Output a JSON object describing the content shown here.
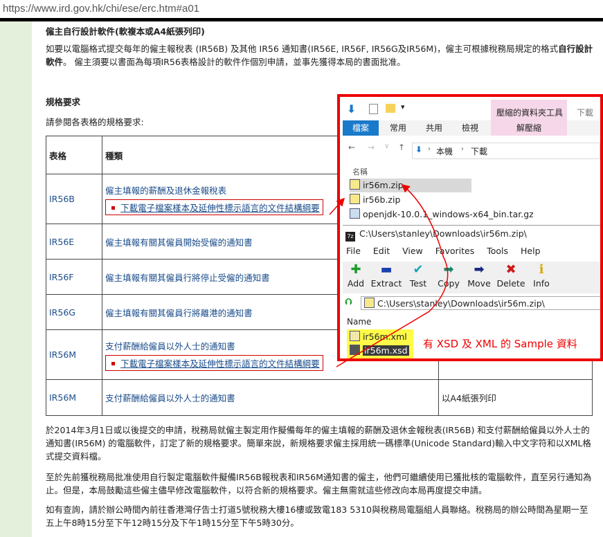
{
  "url": "https://www.ird.gov.hk/chi/ese/erc.htm#a01",
  "section1": {
    "heading": "僱主自行設計軟件(軟複本或A4紙張列印)",
    "para_a": "如要以電腦格式提交每年的僱主報稅表 (IR56B) 及其他 IR56 通知書(IR56E, IR56F, IR56G及IR56M)，僱主可根據稅務局規定的格式",
    "para_bold": "自行設計軟件",
    "para_b": "。 僱主須要以書面為每項IR56表格設計的軟件作個別申請，並事先獲得本局的書面批准。"
  },
  "section2": {
    "heading": "規格要求",
    "intro": "請參閱各表格的規格要求:",
    "col_form": "表格",
    "col_type": "種類",
    "download_label": "下載電子檔案樣本及延伸性標示語言的文件結構綱要",
    "rows": [
      {
        "form": "IR56B",
        "type": "僱主填報的薪酬及退休金報稅表",
        "extra": ""
      },
      {
        "form": "IR56E",
        "type": "僱主填報有關其僱員開始受僱的通知書",
        "extra": ""
      },
      {
        "form": "IR56F",
        "type": "僱主填報有關其僱員行將停止受僱的通知書",
        "extra": ""
      },
      {
        "form": "IR56G",
        "type": "僱主填報有關其僱員行將離港的通知書",
        "extra": ""
      },
      {
        "form": "IR56M",
        "type": "支付薪酬給僱員以外人士的通知書",
        "extra": ""
      },
      {
        "form": "IR56M",
        "type": "支付薪酬給僱員以外人士的通知書",
        "extra": "以A4紙張列印"
      }
    ]
  },
  "para3": "於2014年3月1日或以後提交的申請，稅務局就僱主製定用作擬備每年的僱主填報的薪酬及退休金報稅表(IR56B) 和支付薪酬給僱員以外人士的通知書(IR56M) 的電腦軟件，訂定了新的規格要求。簡單來說，新規格要求僱主採用統一碼標準(Unicode Standard)輸入中文字符和以XML格式提交資料檔。",
  "para4": "至於先前獲稅務局批准使用自行製定電腦軟件擬備IR56B報稅表和IR56M通知書的僱主，他們可繼續使用已獲批核的電腦軟件，直至另行通知為止。但是，本局鼓勵這些僱主儘早修改電腦軟件，以符合新的規格要求。僱主無需就這些修改向本局再度提交申請。",
  "para5": "如有查詢，請於辦公時間內前往香港灣仔告士打道5號稅務大樓16樓或致電183 5310與稅務局電腦組人員聯絡。稅務局的辦公時間為星期一至五上午8時15分至下午12時15分及下午1時15分至下午5時30分。",
  "explorer": {
    "context_tab": "壓縮的資料夾工具",
    "downloads_title": "下載",
    "tabs": [
      "檔案",
      "常用",
      "共用",
      "檢視",
      "解壓縮"
    ],
    "path": [
      "本機",
      "下載"
    ],
    "col_name": "名稱",
    "files": [
      "ir56m.zip",
      "ir56b.zip",
      "openjdk-10.0.1_windows-x64_bin.tar.gz"
    ]
  },
  "sevenzip": {
    "title": "C:\\Users\\stanley\\Downloads\\ir56m.zip\\",
    "menu": [
      "File",
      "Edit",
      "View",
      "Favorites",
      "Tools",
      "Help"
    ],
    "tools": [
      "Add",
      "Extract",
      "Test",
      "Copy",
      "Move",
      "Delete",
      "Info"
    ],
    "path": "C:\\Users\\stanley\\Downloads\\ir56m.zip\\",
    "col_name": "Name",
    "files": [
      "ir56m.xml",
      "ir56m.xsd"
    ]
  },
  "annotation": "有 XSD 及 XML 的 Sample 資料",
  "colors": {
    "accent": "#1979ca",
    "annotation": "#ee0000",
    "highlight": "#fffb48",
    "sidebar": "#e4efdc"
  }
}
